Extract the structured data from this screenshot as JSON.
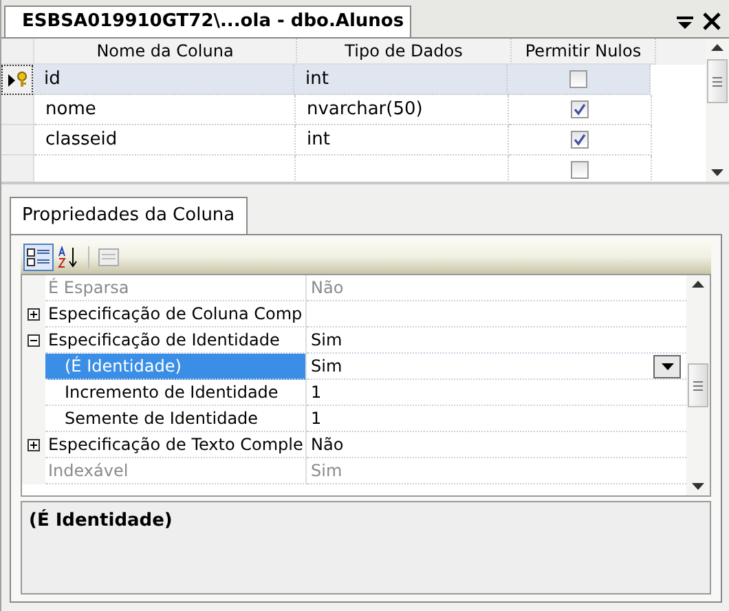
{
  "document_tab": {
    "title": "ESBSA019910GT72\\...ola - dbo.Alunos"
  },
  "table": {
    "columns": [
      "Nome da Coluna",
      "Tipo de Dados",
      "Permitir Nulos"
    ],
    "rows": [
      {
        "name": "id",
        "type": "int",
        "allow_nulls": false,
        "primary_key": true,
        "selected": true
      },
      {
        "name": "nome",
        "type": "nvarchar(50)",
        "allow_nulls": true,
        "primary_key": false,
        "selected": false
      },
      {
        "name": "classeid",
        "type": "int",
        "allow_nulls": true,
        "primary_key": false,
        "selected": false
      },
      {
        "allow_nulls": false,
        "primary_key": false,
        "selected": false
      }
    ]
  },
  "properties_tab": {
    "title": "Propriedades da Coluna"
  },
  "properties": [
    {
      "name": "É Esparsa",
      "value": "Não",
      "disabled": true,
      "selected": false
    },
    {
      "name": "Especificação de Coluna Comp",
      "disabled": false,
      "selected": false,
      "expanded": false
    },
    {
      "name": "Especificação de Identidade",
      "value": "Sim",
      "disabled": false,
      "selected": false,
      "expanded": true,
      "children": [
        {
          "name": "(É Identidade)",
          "value": "Sim",
          "disabled": false,
          "selected": true
        },
        {
          "name": "Incremento de Identidade",
          "value": "1",
          "disabled": false,
          "selected": false
        },
        {
          "name": "Semente de Identidade",
          "value": "1",
          "disabled": false,
          "selected": false
        }
      ]
    },
    {
      "name": "Especificação de Texto Comple",
      "value": "Não",
      "disabled": false,
      "selected": false,
      "expanded": false
    },
    {
      "name": "Indexável",
      "value": "Sim",
      "disabled": true,
      "selected": false
    }
  ],
  "description": {
    "title": "(É Identidade)"
  }
}
